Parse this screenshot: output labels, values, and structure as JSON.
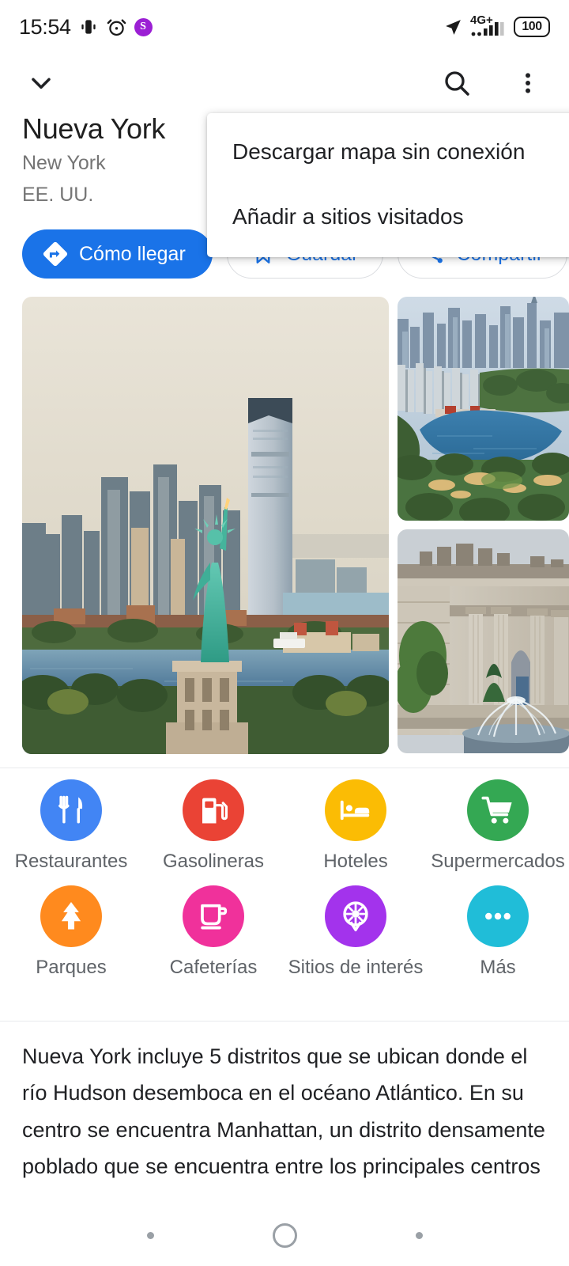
{
  "status_bar": {
    "time": "15:54",
    "vibrate_icon": "vibrate-icon",
    "alarm_icon": "alarm-icon",
    "app_badge_letter": "S",
    "location_icon": "location-arrow-icon",
    "network_label": "4G+",
    "battery_level": "100"
  },
  "app_bar": {
    "collapse_icon": "chevron-down-icon",
    "search_icon": "search-icon",
    "overflow_icon": "more-vertical-icon"
  },
  "place": {
    "title": "Nueva York",
    "subtitle_line1": "New York",
    "subtitle_line2": "EE. UU."
  },
  "actions": [
    {
      "label": "Cómo llegar",
      "icon": "directions-icon",
      "style": "primary"
    },
    {
      "label": "Guardar",
      "icon": "bookmark-icon",
      "style": "outline"
    },
    {
      "label": "Compartir",
      "icon": "share-icon",
      "style": "outline"
    }
  ],
  "overflow_menu": {
    "open": true,
    "items": [
      {
        "label": "Descargar mapa sin conexión"
      },
      {
        "label": "Añadir a sitios visitados"
      }
    ]
  },
  "photos": [
    {
      "name": "statue-of-liberty-photo",
      "alt": "Estatua de la Libertad con el horizonte de la ciudad"
    },
    {
      "name": "central-park-photo",
      "alt": "Vista aérea de Central Park"
    },
    {
      "name": "metropolitan-museum-photo",
      "alt": "Museo Metropolitano de Arte con fuente"
    }
  ],
  "categories": [
    {
      "label": "Restaurantes",
      "icon": "restaurant-icon",
      "color": "#4285F4"
    },
    {
      "label": "Gasolineras",
      "icon": "gas-station-icon",
      "color": "#EA4335"
    },
    {
      "label": "Hoteles",
      "icon": "hotel-bed-icon",
      "color": "#FBBC04"
    },
    {
      "label": "Supermercados",
      "icon": "shopping-cart-icon",
      "color": "#34A853"
    },
    {
      "label": "Parques",
      "icon": "park-tree-icon",
      "color": "#FF8A1E"
    },
    {
      "label": "Cafeterías",
      "icon": "coffee-cup-icon",
      "color": "#F0319B"
    },
    {
      "label": "Sitios de interés",
      "icon": "ferris-wheel-icon",
      "color": "#A333EC"
    },
    {
      "label": "Más",
      "icon": "more-dots-icon",
      "color": "#20BDD8"
    }
  ],
  "description": "Nueva York incluye 5 distritos que se ubican donde el río Hudson desemboca en el océano Atlántico. En su centro se encuentra Manhattan, un distrito densamente poblado que se encuentra entre los principales centros",
  "nav_bar": {
    "back_icon": "nav-dot-icon",
    "home_icon": "nav-home-circle-icon",
    "recents_icon": "nav-dot-icon"
  },
  "theme": {
    "accent_blue": "#1a73e8",
    "text_primary": "#202124",
    "text_secondary": "#5f6368",
    "divider": "#e8eaed"
  }
}
